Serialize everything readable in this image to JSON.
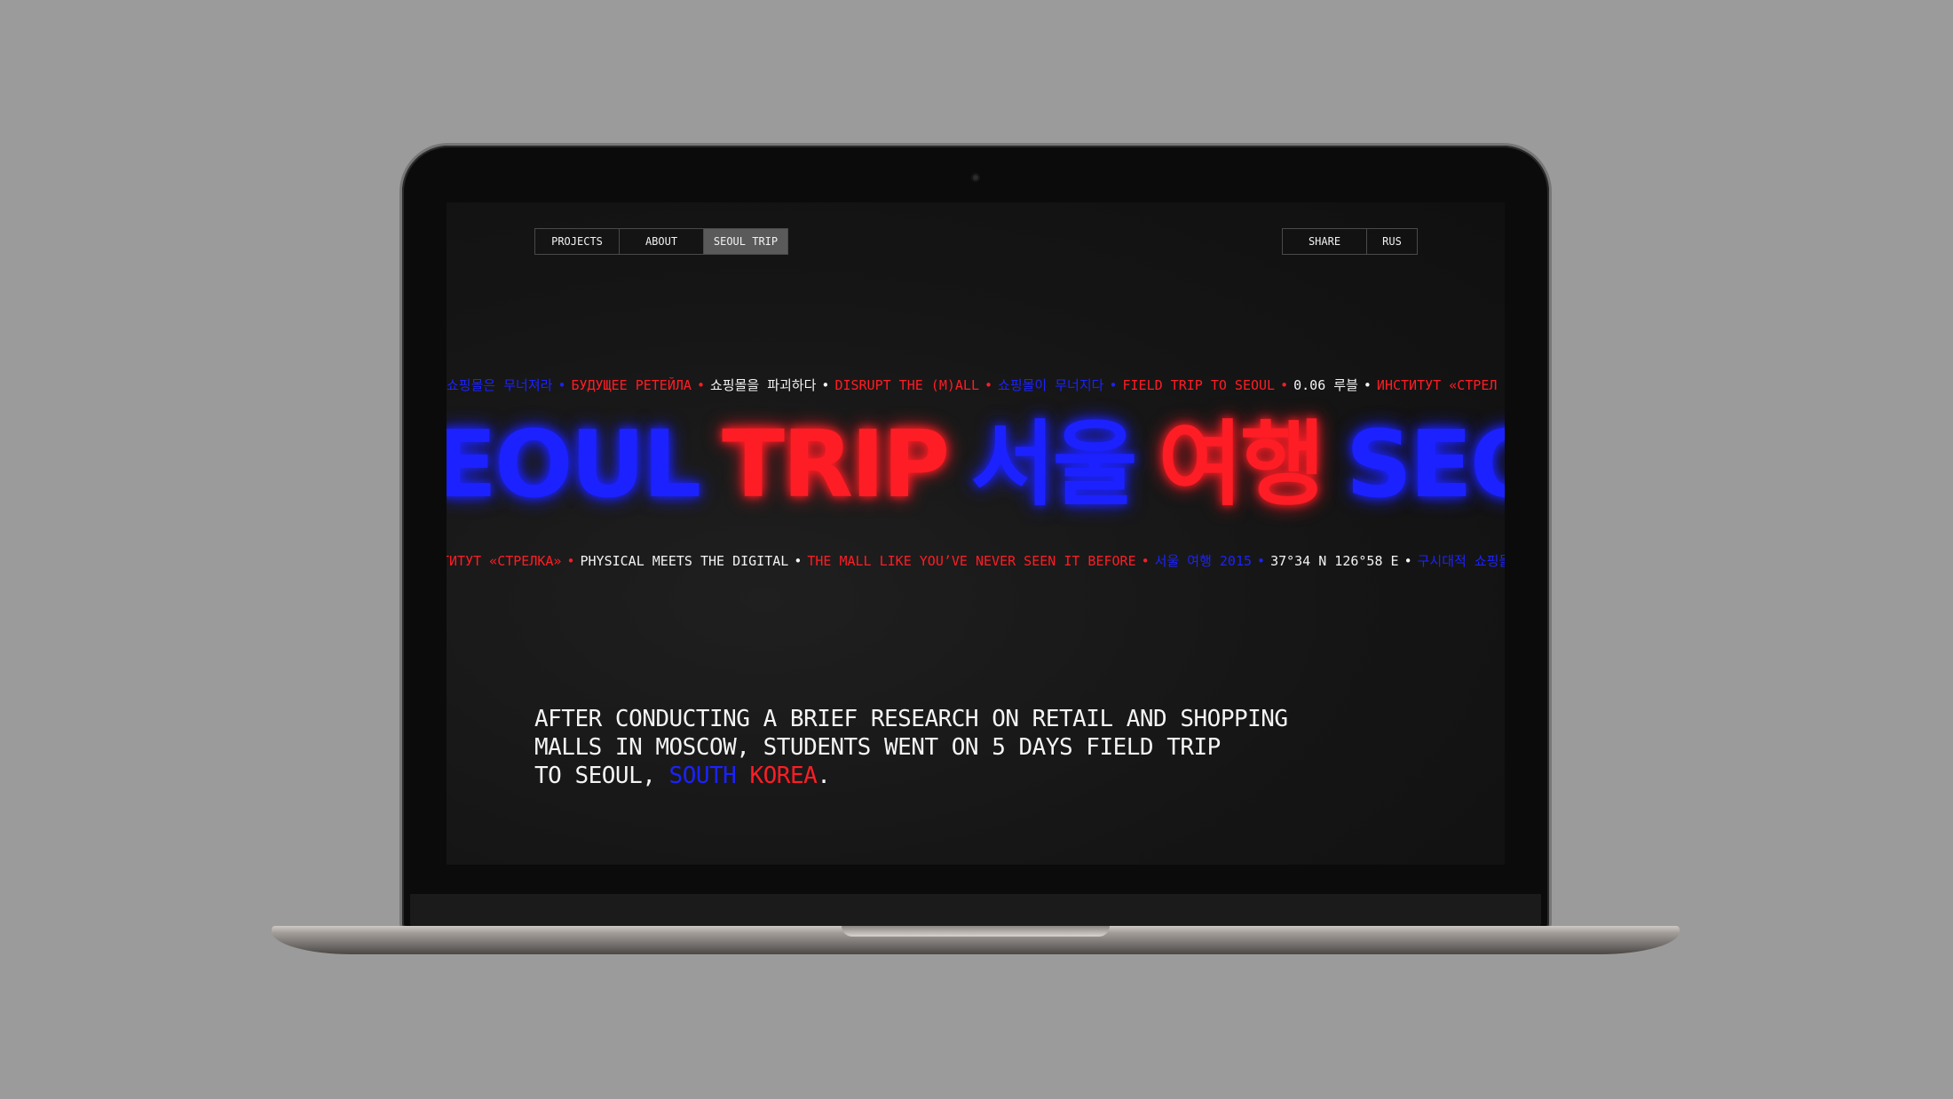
{
  "colors": {
    "blue": "#1c22ff",
    "red": "#ff1d25",
    "white": "#f4f4f4"
  },
  "nav": {
    "left": [
      {
        "label": "PROJECTS",
        "active": false
      },
      {
        "label": "ABOUT",
        "active": false
      },
      {
        "label": "SEOUL TRIP",
        "active": true
      }
    ],
    "right": [
      {
        "label": "SHARE"
      },
      {
        "label": "RUS"
      }
    ]
  },
  "ticker_top": [
    {
      "text": "쇼핑몰은 무너져라",
      "color": "blue"
    },
    {
      "text": "•",
      "color": "blue"
    },
    {
      "text": "БУДУЩЕЕ РЕТЕЙЛА",
      "color": "red"
    },
    {
      "text": "•",
      "color": "red"
    },
    {
      "text": "쇼핑몰을 파괴하다",
      "color": "white"
    },
    {
      "text": "•",
      "color": "white"
    },
    {
      "text": "DISRUPT THE (M)ALL",
      "color": "red"
    },
    {
      "text": "•",
      "color": "red"
    },
    {
      "text": "쇼핑몰이 무너지다",
      "color": "blue"
    },
    {
      "text": "•",
      "color": "blue"
    },
    {
      "text": "FIELD TRIP TO SEOUL",
      "color": "red"
    },
    {
      "text": "•",
      "color": "red"
    },
    {
      "text": "0.06 루블",
      "color": "white"
    },
    {
      "text": "•",
      "color": "white"
    },
    {
      "text": "ИНСТИТУТ «СТРЕЛ",
      "color": "red"
    }
  ],
  "big_title": [
    {
      "text": "EOUL",
      "color": "blue"
    },
    {
      "text": "TRIP",
      "color": "red"
    },
    {
      "text": "서울",
      "color": "blue"
    },
    {
      "text": "여행",
      "color": "red"
    },
    {
      "text": "SEOU",
      "color": "blue"
    }
  ],
  "ticker_bottom": [
    {
      "text": "ТИТУТ «СТРЕЛКА»",
      "color": "red"
    },
    {
      "text": "•",
      "color": "red"
    },
    {
      "text": "PHYSICAL MEETS THE DIGITAL",
      "color": "white"
    },
    {
      "text": "•",
      "color": "white"
    },
    {
      "text": "THE MALL LIKE YOU’VE NEVER SEEN IT BEFORE",
      "color": "red"
    },
    {
      "text": "•",
      "color": "red"
    },
    {
      "text": "서울 여행 2015",
      "color": "blue"
    },
    {
      "text": "•",
      "color": "blue"
    },
    {
      "text": "37°34 N 126°58 E",
      "color": "white"
    },
    {
      "text": "•",
      "color": "white"
    },
    {
      "text": "구시대적 쇼핑몰은",
      "color": "blue"
    }
  ],
  "body": {
    "line1": "AFTER CONDUCTING A BRIEF RESEARCH ON RETAIL AND SHOPPING",
    "line2": "MALLS IN MOSCOW, STUDENTS WENT ON 5 DAYS FIELD TRIP",
    "line3_prefix": "TO SEOUL, ",
    "highlight_south": "SOUTH",
    "highlight_korea": "KOREA",
    "suffix": "."
  }
}
